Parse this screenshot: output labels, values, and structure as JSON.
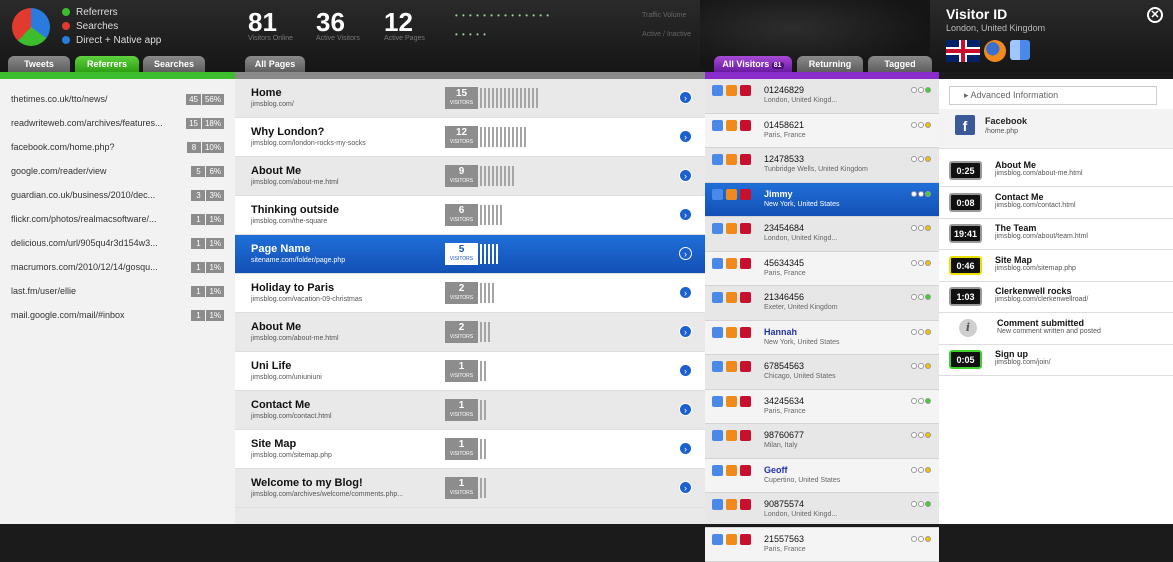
{
  "legend": [
    {
      "label": "Referrers",
      "color": "#3bbd2e"
    },
    {
      "label": "Searches",
      "color": "#e23a2e"
    },
    {
      "label": "Direct + Native app",
      "color": "#2a7be0"
    }
  ],
  "stats": [
    {
      "num": "81",
      "label": "Visitors Online"
    },
    {
      "num": "36",
      "label": "Active Visitors"
    },
    {
      "num": "12",
      "label": "Active Pages"
    }
  ],
  "traffic": {
    "volume": "Traffic Volume",
    "active": "Active / Inactive"
  },
  "visitor": {
    "title": "Visitor ID",
    "location": "London, United Kingdom",
    "close": "✕"
  },
  "tabs_left": {
    "tweets": "Tweets",
    "referrers": "Referrers",
    "searches": "Searches",
    "all_pages": "All Pages"
  },
  "tabs_right": {
    "all_visitors": "All Visitors",
    "count": "81",
    "returning": "Returning",
    "tagged": "Tagged"
  },
  "referrers": [
    {
      "url": "thetimes.co.uk/tto/news/",
      "a": "45",
      "b": "56%"
    },
    {
      "url": "readwriteweb.com/archives/features...",
      "a": "15",
      "b": "18%"
    },
    {
      "url": "facebook.com/home.php?",
      "a": "8",
      "b": "10%"
    },
    {
      "url": "google.com/reader/view",
      "a": "5",
      "b": "6%"
    },
    {
      "url": "guardian.co.uk/business/2010/dec...",
      "a": "3",
      "b": "3%"
    },
    {
      "url": "flickr.com/photos/realmacsoftware/...",
      "a": "1",
      "b": "1%"
    },
    {
      "url": "delicious.com/url/905qu4r3d154w3...",
      "a": "1",
      "b": "1%"
    },
    {
      "url": "macrumors.com/2010/12/14/gosqu...",
      "a": "1",
      "b": "1%"
    },
    {
      "url": "last.fm/user/ellie",
      "a": "1",
      "b": "1%"
    },
    {
      "url": "mail.google.com/mail/#inbox",
      "a": "1",
      "b": "1%"
    }
  ],
  "visitors_label": "VISITORS",
  "pages": [
    {
      "name": "Home",
      "url": "jimsblog.com/",
      "count": "15",
      "bars": 15
    },
    {
      "name": "Why London?",
      "url": "jimsblog.com/london-rocks-my-socks",
      "count": "12",
      "bars": 12
    },
    {
      "name": "About Me",
      "url": "jimsblog.com/about-me.html",
      "count": "9",
      "bars": 9
    },
    {
      "name": "Thinking outside",
      "url": "jimsblog.com/the-square",
      "count": "6",
      "bars": 6
    },
    {
      "name": "Page Name",
      "url": "sitename.com/folder/page.php",
      "count": "5",
      "bars": 5,
      "selected": true
    },
    {
      "name": "Holiday to Paris",
      "url": "jimsblog.com/vacation-09-christmas",
      "count": "2",
      "bars": 4
    },
    {
      "name": "About Me",
      "url": "jimsblog.com/about-me.html",
      "count": "2",
      "bars": 3
    },
    {
      "name": "Uni Life",
      "url": "jimsblog.com/uniuniuni",
      "count": "1",
      "bars": 2
    },
    {
      "name": "Contact Me",
      "url": "jimsblog.com/contact.html",
      "count": "1",
      "bars": 2
    },
    {
      "name": "Site Map",
      "url": "jimsblog.com/sitemap.php",
      "count": "1",
      "bars": 2
    },
    {
      "name": "Welcome to my Blog!",
      "url": "jimsblog.com/archives/welcome/comments.php...",
      "count": "1",
      "bars": 2
    }
  ],
  "visitors": [
    {
      "id": "01246829",
      "loc": "London, United Kingd..."
    },
    {
      "id": "01458621",
      "loc": "Paris, France"
    },
    {
      "id": "12478533",
      "loc": "Tunbridge Wells, United Kingdom"
    },
    {
      "id": "Jimmy",
      "loc": "New York, United States",
      "named": true,
      "selected": true
    },
    {
      "id": "23454684",
      "loc": "London, United Kingd..."
    },
    {
      "id": "45634345",
      "loc": "Paris, France"
    },
    {
      "id": "21346456",
      "loc": "Exeter, United Kingdom"
    },
    {
      "id": "Hannah",
      "loc": "New York, United States",
      "named": true
    },
    {
      "id": "67854563",
      "loc": "Chicago, United States"
    },
    {
      "id": "34245634",
      "loc": "Paris, France"
    },
    {
      "id": "98760677",
      "loc": "Milan, Italy"
    },
    {
      "id": "Geoff",
      "loc": "Cupertino, United States",
      "named": true
    },
    {
      "id": "90875574",
      "loc": "London, United Kingd..."
    },
    {
      "id": "21557563",
      "loc": "Paris, France"
    }
  ],
  "detail": {
    "advanced": "Advanced Information",
    "source": {
      "name": "Facebook",
      "url": "/home.php"
    },
    "events": [
      {
        "time": "0:25",
        "title": "About Me",
        "url": "jimsblog.com/about-me.html",
        "style": ""
      },
      {
        "time": "0:08",
        "title": "Contact Me",
        "url": "jimsblog.com/contact.html",
        "style": ""
      },
      {
        "time": "19:41",
        "title": "The Team",
        "url": "jimsblog.com/about/team.html",
        "style": ""
      },
      {
        "time": "0:46",
        "title": "Site Map",
        "url": "jimsblog.com/sitemap.php",
        "style": "y"
      },
      {
        "time": "1:03",
        "title": "Clerkenwell rocks",
        "url": "jimsblog.com/clerkenwellroad/",
        "style": ""
      },
      {
        "time": "",
        "title": "Comment submitted",
        "url": "New comment written and posted",
        "style": "info"
      },
      {
        "time": "0:05",
        "title": "Sign up",
        "url": "jimsblog.com/join/",
        "style": "g"
      }
    ]
  }
}
